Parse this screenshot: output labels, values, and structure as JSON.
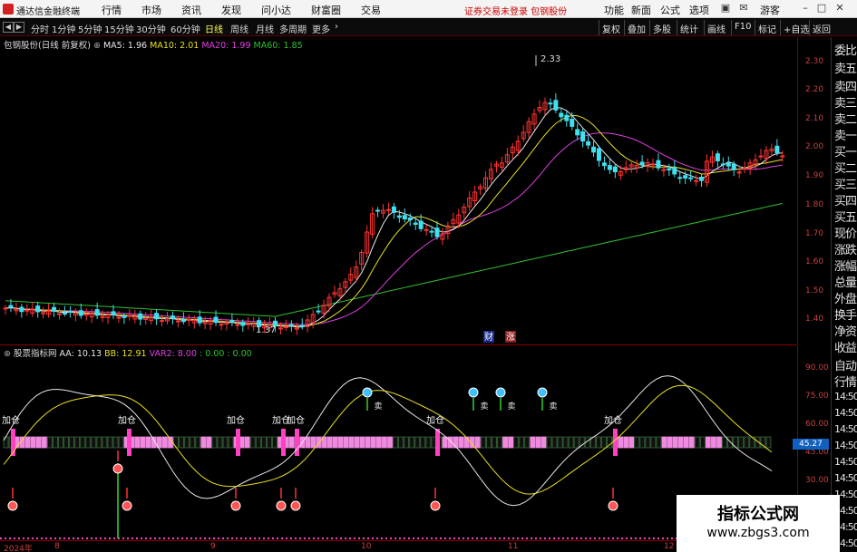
{
  "app": {
    "title": "通达信金融终端",
    "status": "证券交易未登录  包钢股份"
  },
  "menu": [
    "行情",
    "市场",
    "资讯",
    "发现",
    "问小达",
    "财富圈",
    "交易"
  ],
  "menu_right": [
    "功能",
    "新面",
    "公式",
    "选项",
    "游客"
  ],
  "periods": [
    "分时",
    "1分钟",
    "5分钟",
    "15分钟",
    "30分钟",
    "60分钟",
    "日线",
    "周线",
    "月线",
    "多周期",
    "更多"
  ],
  "active_period": "日线",
  "right_tools": [
    "复权",
    "叠加",
    "多股",
    "统计",
    "画线",
    "F10",
    "标记",
    "+自选",
    "返回"
  ],
  "main_chart": {
    "stock_label": "包钢股份(日线 前复权)",
    "ma": [
      {
        "label": "MA5: 1.96",
        "color": "#e8e8e8"
      },
      {
        "label": "MA10: 2.01",
        "color": "#e8e020"
      },
      {
        "label": "MA20: 1.99",
        "color": "#e040e0"
      },
      {
        "label": "MA60: 1.85",
        "color": "#30c030"
      }
    ],
    "y_ticks": [
      "2.30",
      "2.20",
      "2.10",
      "2.00",
      "1.90",
      "1.80",
      "1.70",
      "1.60",
      "1.50",
      "1.40"
    ],
    "high_label": "2.33",
    "low_label": "1.37",
    "finance_marks": [
      "财",
      "涨"
    ],
    "colors": {
      "up": "#ff3333",
      "down": "#3fe0f0"
    }
  },
  "side_panel": [
    "委比",
    "卖五",
    "卖四",
    "卖三",
    "卖二",
    "卖一",
    "买一",
    "买二",
    "买三",
    "买四",
    "买五",
    "现价",
    "涨跌",
    "涨幅",
    "总量",
    "外盘",
    "换手",
    "净资",
    "收益",
    "自动",
    "行情",
    "14:50",
    "14:50",
    "14:50",
    "14:50",
    "14:50",
    "14:50",
    "14:50",
    "14:50",
    "14:50",
    "14:50"
  ],
  "sub_chart": {
    "indicator": "股票指标网",
    "values": [
      {
        "label": "AA: 10.13",
        "color": "#e8e8e8"
      },
      {
        "label": "BB: 12.91",
        "color": "#e8e020"
      },
      {
        "label": "VAR2: 8.00",
        "color": "#e040e0"
      },
      {
        "label": ": 0.00",
        "color": "#30c030"
      },
      {
        "label": ": 0.00",
        "color": "#30c030"
      }
    ],
    "y_ticks": [
      "90.00",
      "75.00",
      "60.00",
      "45.00",
      "30.00"
    ],
    "current_value": "45.27",
    "add_label": "加仓",
    "sell_label": "卖"
  },
  "date_axis": [
    "2024年",
    "8",
    "9",
    "10",
    "11",
    "12"
  ],
  "watermark": {
    "title": "指标公式网",
    "url": "www.zbgs3.com"
  }
}
